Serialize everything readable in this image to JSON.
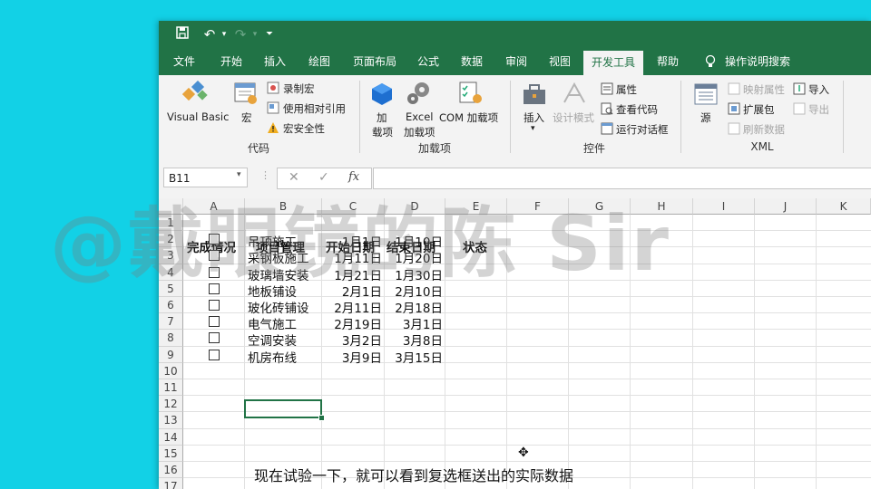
{
  "menu": {
    "items": [
      "文件",
      "开始",
      "插入",
      "绘图",
      "页面布局",
      "公式",
      "数据",
      "审阅",
      "视图",
      "开发工具",
      "帮助"
    ],
    "search": "操作说明搜索",
    "active": "开发工具"
  },
  "ribbon": {
    "code": {
      "visual_basic": "Visual Basic",
      "macro": "宏",
      "record_macro": "录制宏",
      "relative_ref": "使用相对引用",
      "macro_security": "宏安全性",
      "label": "代码"
    },
    "addins": {
      "addin": [
        "加",
        "载项"
      ],
      "excel_addin": [
        "Excel",
        "加载项"
      ],
      "com_addin": "COM 加载项",
      "label": "加载项"
    },
    "controls": {
      "insert": "插入",
      "design_mode": "设计模式",
      "properties": "属性",
      "view_code": "查看代码",
      "run_dialog": "运行对话框",
      "label": "控件"
    },
    "xml": {
      "source": "源",
      "map_props": "映射属性",
      "expansion_pack": "扩展包",
      "refresh_data": "刷新数据",
      "import": "导入",
      "export": "导出",
      "label": "XML"
    }
  },
  "formula_bar": {
    "name_box": "B11",
    "formula": ""
  },
  "columns": [
    "A",
    "B",
    "C",
    "D",
    "E",
    "F",
    "G",
    "H",
    "I",
    "J",
    "K"
  ],
  "rows": [
    "1",
    "2",
    "3",
    "4",
    "5",
    "6",
    "7",
    "8",
    "9",
    "10",
    "11",
    "12",
    "13",
    "14",
    "15",
    "16",
    "17"
  ],
  "headers": {
    "a": "完成情况",
    "b": "项目管理",
    "c": "开始日期",
    "d": "结束日期",
    "e": "状态"
  },
  "tasks": [
    {
      "name": "吊顶施工",
      "start": "1月1日",
      "end": "1月10日"
    },
    {
      "name": "采钢板施工",
      "start": "1月11日",
      "end": "1月20日"
    },
    {
      "name": "玻璃墙安装",
      "start": "1月21日",
      "end": "1月30日"
    },
    {
      "name": "地板铺设",
      "start": "2月1日",
      "end": "2月10日"
    },
    {
      "name": "玻化砖铺设",
      "start": "2月11日",
      "end": "2月18日"
    },
    {
      "name": "电气施工",
      "start": "2月19日",
      "end": "3月1日"
    },
    {
      "name": "空调安装",
      "start": "3月2日",
      "end": "3月8日"
    },
    {
      "name": "机房布线",
      "start": "3月9日",
      "end": "3月15日"
    }
  ],
  "watermark": "@戴眼镜的陈 Sir",
  "subtitle": "现在试验一下，就可以看到复选框送出的实际数据",
  "colors": {
    "excel_green": "#217346",
    "background": "#12d1e6"
  }
}
